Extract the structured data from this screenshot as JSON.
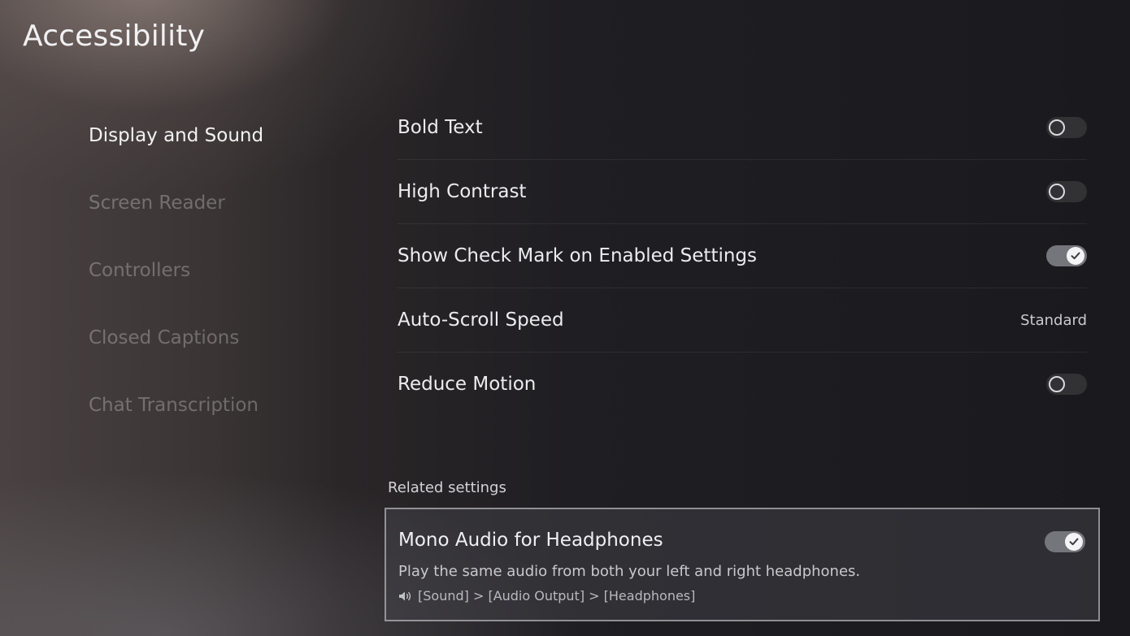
{
  "header": {
    "title": "Accessibility"
  },
  "sidebar": {
    "items": [
      {
        "label": "Display and Sound",
        "active": true
      },
      {
        "label": "Screen Reader",
        "active": false
      },
      {
        "label": "Controllers",
        "active": false
      },
      {
        "label": "Closed Captions",
        "active": false
      },
      {
        "label": "Chat Transcription",
        "active": false
      }
    ]
  },
  "settings": {
    "items": [
      {
        "label": "Bold Text",
        "control": "toggle",
        "state": "off"
      },
      {
        "label": "High Contrast",
        "control": "toggle",
        "state": "off"
      },
      {
        "label": "Show Check Mark on Enabled Settings",
        "control": "toggle",
        "state": "on"
      },
      {
        "label": "Auto-Scroll Speed",
        "control": "value",
        "value": "Standard"
      },
      {
        "label": "Reduce Motion",
        "control": "toggle",
        "state": "off"
      }
    ]
  },
  "related": {
    "heading": "Related settings",
    "card": {
      "title": "Mono Audio for Headphones",
      "state": "on",
      "description": "Play the same audio from both your left and right headphones.",
      "path": "[Sound] > [Audio Output] > [Headphones]",
      "path_icon": "speaker-icon"
    }
  }
}
